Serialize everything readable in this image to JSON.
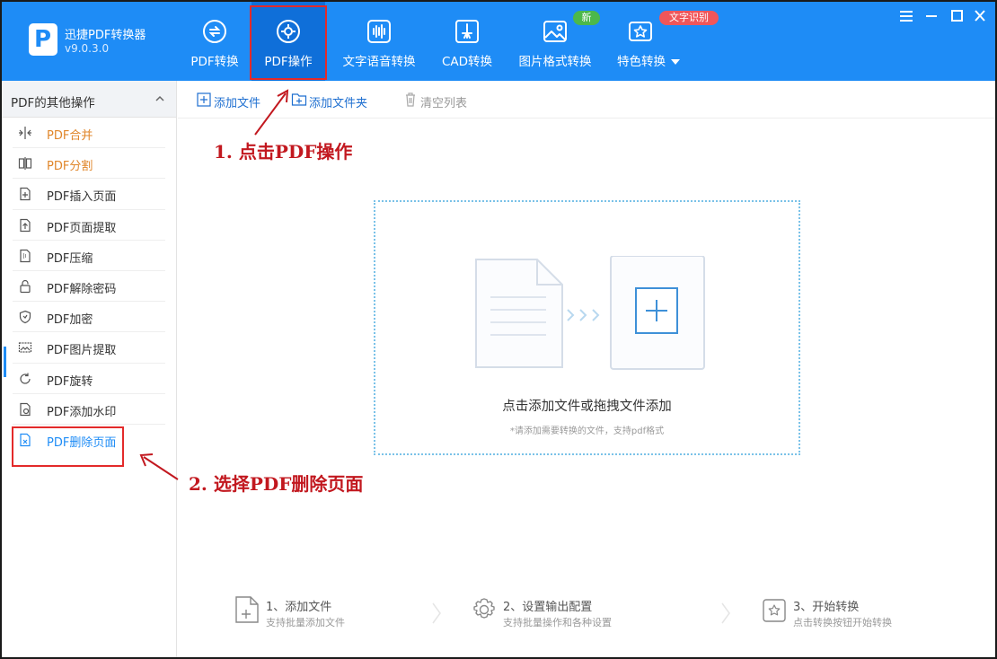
{
  "app": {
    "name": "迅捷PDF转换器",
    "version": "v9.0.3.0",
    "logo_letter": "P"
  },
  "nav": {
    "tabs": [
      {
        "label": "PDF转换",
        "icon": "pdf-convert-icon"
      },
      {
        "label": "PDF操作",
        "icon": "pdf-operation-icon",
        "active": true
      },
      {
        "label": "文字语音转换",
        "icon": "audio-wave-icon"
      },
      {
        "label": "CAD转换",
        "icon": "cad-icon"
      },
      {
        "label": "图片格式转换",
        "icon": "image-icon"
      },
      {
        "label": "特色转换",
        "icon": "feature-star-icon"
      }
    ],
    "badge_new": "新",
    "badge_ocr": "文字识别"
  },
  "window_controls": {
    "icons": [
      "menu-icon",
      "minimize-icon",
      "maximize-icon",
      "close-icon"
    ]
  },
  "sidebar": {
    "title": "PDF的其他操作",
    "items": [
      {
        "label": "PDF合并",
        "icon": "merge-icon"
      },
      {
        "label": "PDF分割",
        "icon": "split-icon"
      },
      {
        "label": "PDF插入页面",
        "icon": "insert-page-icon"
      },
      {
        "label": "PDF页面提取",
        "icon": "extract-page-icon"
      },
      {
        "label": "PDF压缩",
        "icon": "compress-icon"
      },
      {
        "label": "PDF解除密码",
        "icon": "unlock-icon"
      },
      {
        "label": "PDF加密",
        "icon": "shield-icon"
      },
      {
        "label": "PDF图片提取",
        "icon": "image-extract-icon"
      },
      {
        "label": "PDF旋转",
        "icon": "rotate-icon"
      },
      {
        "label": "PDF添加水印",
        "icon": "watermark-icon"
      },
      {
        "label": "PDF删除页面",
        "icon": "delete-page-icon",
        "selected": true
      }
    ]
  },
  "toolbar": {
    "add_file": "添加文件",
    "add_folder": "添加文件夹",
    "clear_list": "清空列表"
  },
  "drop_zone": {
    "text": "点击添加文件或拖拽文件添加",
    "hint": "*请添加需要转换的文件，支持pdf格式"
  },
  "annotations": {
    "step1": "1. 点击PDF操作",
    "step2": "2. 选择PDF删除页面"
  },
  "steps": [
    {
      "title": "1、添加文件",
      "subtitle": "支持批量添加文件",
      "icon": "add-file-icon"
    },
    {
      "title": "2、设置输出配置",
      "subtitle": "支持批量操作和各种设置",
      "icon": "settings-gear-icon"
    },
    {
      "title": "3、开始转换",
      "subtitle": "点击转换按钮开始转换",
      "icon": "start-convert-icon"
    }
  ],
  "colors": {
    "header_blue": "#1E8CF6",
    "accent_orange": "#E0862A",
    "annotation_red": "#C2181F",
    "badge_green": "#4CB84A",
    "badge_red": "#F0565A"
  }
}
